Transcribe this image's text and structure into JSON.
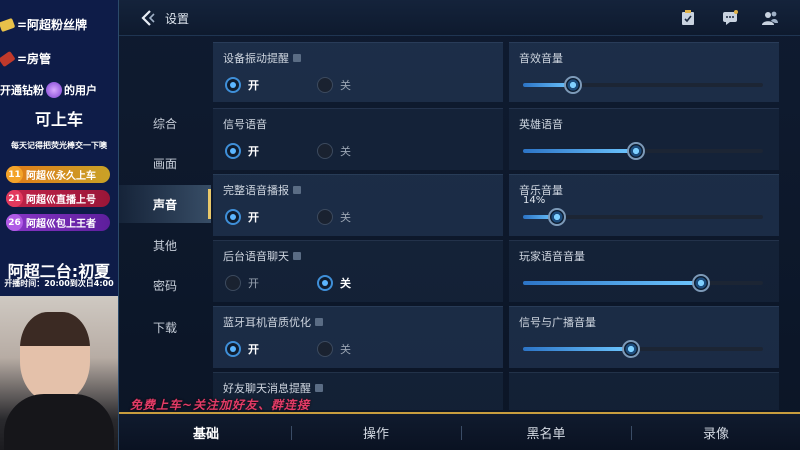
{
  "overlay": {
    "fans_badge": "=阿超粉丝牌",
    "room_admin": "=房管",
    "open_diamond_prefix": "开通钻粉",
    "open_diamond_suffix": "的用户",
    "can_board": "可上车",
    "daily_note": "每天记得把荧光棒交一下噢",
    "tags": [
      {
        "num": "11",
        "text": "阿超巛永久上车"
      },
      {
        "num": "21",
        "text": "阿超巛直播上号"
      },
      {
        "num": "26",
        "text": "阿超巛包上王者"
      }
    ],
    "channel": "阿超二台:初夏",
    "schedule": "开播时间：20:00到次日4:00",
    "promo": "免费上车~关注加好友、群连接"
  },
  "topbar": {
    "title": "设置",
    "icons": [
      "back-icon",
      "tasks-icon",
      "chat-icon",
      "friends-icon"
    ]
  },
  "sidenav": {
    "items": [
      {
        "label": "综合"
      },
      {
        "label": "画面"
      },
      {
        "label": "声音",
        "active": true
      },
      {
        "label": "其他"
      },
      {
        "label": "密码"
      },
      {
        "label": "下载"
      }
    ]
  },
  "settings": {
    "on_label": "开",
    "off_label": "关",
    "toggles": [
      {
        "label": "设备振动提醒",
        "value": "开"
      },
      {
        "label": "信号语音",
        "value": "开"
      },
      {
        "label": "完整语音播报",
        "value": "开"
      },
      {
        "label": "后台语音聊天",
        "value": "关"
      },
      {
        "label": "蓝牙耳机音质优化",
        "value": "开"
      },
      {
        "label": "好友聊天消息提醒"
      }
    ],
    "sliders": [
      {
        "label": "音效音量",
        "value": 21
      },
      {
        "label": "英雄语音",
        "value": 47
      },
      {
        "label": "音乐音量",
        "value": 14,
        "display": "14%"
      },
      {
        "label": "玩家语音音量",
        "value": 74
      },
      {
        "label": "信号与广播音量",
        "value": 45
      }
    ]
  },
  "bottom_tabs": [
    {
      "label": "基础",
      "active": true
    },
    {
      "label": "操作"
    },
    {
      "label": "黑名单"
    },
    {
      "label": "录像"
    }
  ],
  "colors": {
    "accent": "#5cb6ff",
    "gold": "#c79d3e",
    "promo": "#e33c68"
  }
}
